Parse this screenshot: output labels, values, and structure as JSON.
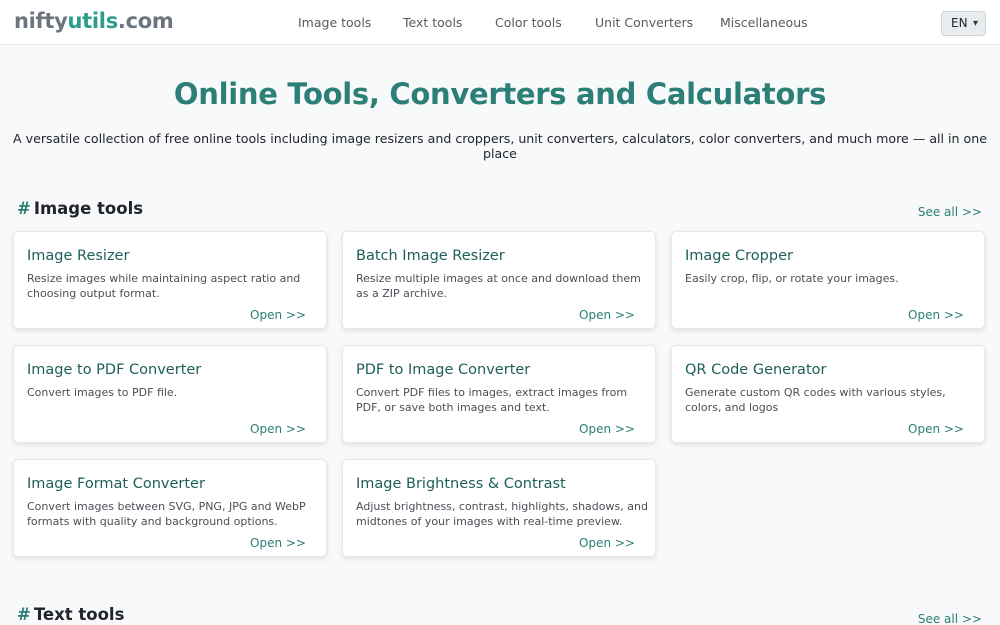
{
  "header": {
    "logo_part1": "nifty",
    "logo_part2": "utils",
    "logo_part3": ".com",
    "nav": [
      "Image tools",
      "Text tools",
      "Color tools",
      "Unit Converters",
      "Miscellaneous"
    ],
    "language": "EN"
  },
  "hero": {
    "title": "Online Tools, Converters and Calculators",
    "subtitle": "A versatile collection of free online tools including image resizers and croppers, unit converters, calculators, color converters, and much more — all in one place"
  },
  "sections": [
    {
      "hash": "#",
      "title": "Image tools",
      "see_all": "See all >>",
      "cards": [
        {
          "title": "Image Resizer",
          "desc": "Resize images while maintaining aspect ratio and choosing output format.",
          "open": "Open >>"
        },
        {
          "title": "Batch Image Resizer",
          "desc": "Resize multiple images at once and download them as a ZIP archive.",
          "open": "Open >>"
        },
        {
          "title": "Image Cropper",
          "desc": "Easily crop, flip, or rotate your images.",
          "open": "Open >>"
        },
        {
          "title": "Image to PDF Converter",
          "desc": "Convert images to PDF file.",
          "open": "Open >>"
        },
        {
          "title": "PDF to Image Converter",
          "desc": "Convert PDF files to images, extract images from PDF, or save both images and text.",
          "open": "Open >>"
        },
        {
          "title": "QR Code Generator",
          "desc": "Generate custom QR codes with various styles, colors, and logos",
          "open": "Open >>"
        },
        {
          "title": "Image Format Converter",
          "desc": "Convert images between SVG, PNG, JPG and WebP formats with quality and background options.",
          "open": "Open >>"
        },
        {
          "title": "Image Brightness & Contrast",
          "desc": "Adjust brightness, contrast, highlights, shadows, and midtones of your images with real-time preview.",
          "open": "Open >>"
        }
      ]
    },
    {
      "hash": "#",
      "title": "Text tools",
      "see_all": "See all >>",
      "cards": []
    }
  ]
}
